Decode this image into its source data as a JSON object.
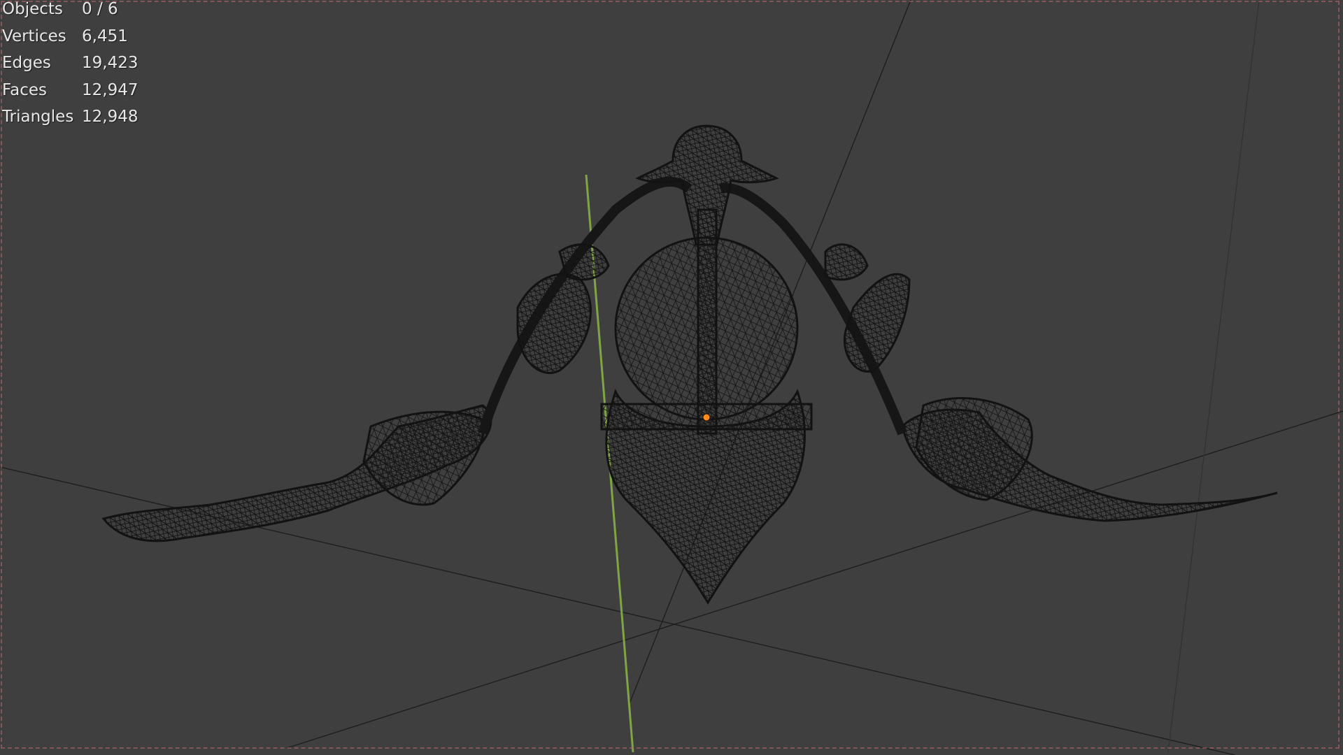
{
  "viewport": {
    "background_color": "#3f3f3f",
    "frame_border_color": "#b96a6a"
  },
  "scene": {
    "grid_line_color": "#1c1c1c",
    "y_axis_color": "#7fa545",
    "mesh_wire_color": "#141414",
    "origin_color": "#ff8c1a",
    "object": "ornament-wireframe-mesh"
  },
  "stats": [
    {
      "label": "Objects",
      "value": "0 / 6"
    },
    {
      "label": "Vertices",
      "value": "6,451"
    },
    {
      "label": "Edges",
      "value": "19,423"
    },
    {
      "label": "Faces",
      "value": "12,947"
    },
    {
      "label": "Triangles",
      "value": "12,948"
    }
  ]
}
